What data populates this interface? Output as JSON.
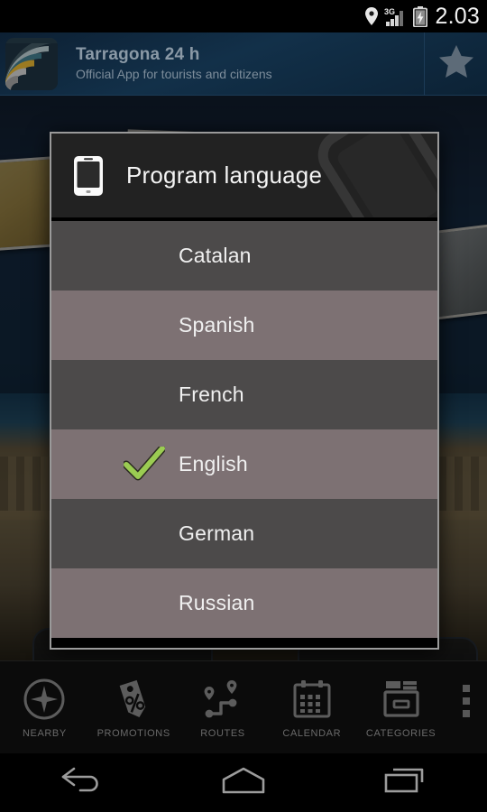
{
  "status_bar": {
    "time": "2.03",
    "icons": [
      "location-pin-icon",
      "signal-3g-icon",
      "battery-charging-icon"
    ],
    "network_label": "3G"
  },
  "app_header": {
    "title": "Tarragona 24 h",
    "subtitle": "Official App for tourists and citizens",
    "logo_name": "app-logo",
    "favorite_icon": "star-icon",
    "colors": {
      "background_start": "#0d2033",
      "background_end": "#0c2235",
      "title_text": "#8a99a6",
      "subtitle_text": "#7d8d9b",
      "star": "#5d6b78"
    }
  },
  "dialog": {
    "title": "Program language",
    "icon": "phone-icon",
    "watermark_icon": "phone-watermark-icon",
    "colors": {
      "header_bg": "#222222",
      "border": "#9a9a9a",
      "row_odd": "#4c4a4a",
      "row_even": "#7d7173",
      "row_text": "#f0f0f0",
      "check": "#8fc64f"
    },
    "options": [
      {
        "label": "Catalan",
        "selected": false
      },
      {
        "label": "Spanish",
        "selected": false
      },
      {
        "label": "French",
        "selected": false
      },
      {
        "label": "English",
        "selected": true
      },
      {
        "label": "German",
        "selected": false
      },
      {
        "label": "Russian",
        "selected": false
      }
    ]
  },
  "tab_bar": {
    "items": [
      {
        "label": "NEARBY",
        "icon": "compass-icon"
      },
      {
        "label": "PROMOTIONS",
        "icon": "discount-tag-icon"
      },
      {
        "label": "ROUTES",
        "icon": "route-pins-icon"
      },
      {
        "label": "CALENDAR",
        "icon": "calendar-icon"
      },
      {
        "label": "CATEGORIES",
        "icon": "file-box-icon"
      }
    ],
    "overflow_icon": "overflow-menu-icon",
    "label_color": "#6a6a6a"
  },
  "nav_bar": {
    "buttons": [
      {
        "name": "back-button",
        "icon": "back-arrow-icon"
      },
      {
        "name": "home-button",
        "icon": "home-icon"
      },
      {
        "name": "recents-button",
        "icon": "recents-icon"
      }
    ]
  }
}
